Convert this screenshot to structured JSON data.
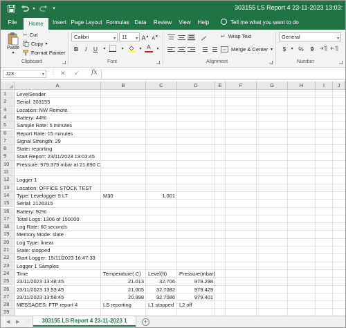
{
  "window": {
    "title": "303155 LS Report 4 23-11-2023 13:03:"
  },
  "quick_access": {
    "save_icon": "save-icon",
    "undo_icon": "undo-icon",
    "redo_icon": "redo-icon",
    "customize_icon": "customize-icon"
  },
  "ribbon_tabs": [
    "File",
    "Home",
    "Insert",
    "Page Layout",
    "Formulas",
    "Data",
    "Review",
    "View",
    "Help"
  ],
  "active_tab": "Home",
  "tell_me": "Tell me what you want to do",
  "ribbon": {
    "clipboard": {
      "paste": "Paste",
      "cut": "Cut",
      "copy": "Copy",
      "format_painter": "Format Painter",
      "label": "Clipboard"
    },
    "font": {
      "name": "Calibri",
      "size": "11",
      "grow": "A",
      "shrink": "A",
      "bold": "B",
      "italic": "I",
      "underline": "U",
      "font_color_letter": "A",
      "label": "Font"
    },
    "alignment": {
      "wrap_text": "Wrap Text",
      "merge_center": "Merge & Center",
      "label": "Alignment"
    },
    "number": {
      "format": "General",
      "currency": "$",
      "percent": "%",
      "comma": "9",
      "label": "Number"
    }
  },
  "formula_bar": {
    "name_box": "J23",
    "cancel": "✕",
    "enter": "✓",
    "fx": "fx",
    "value": ""
  },
  "columns": [
    "A",
    "B",
    "C",
    "D",
    "E",
    "F",
    "G",
    "H",
    "I",
    "J"
  ],
  "rows": [
    "1",
    "2",
    "3",
    "4",
    "5",
    "6",
    "7",
    "8",
    "9",
    "10",
    "11",
    "12",
    "13",
    "14",
    "15",
    "16",
    "17",
    "18",
    "19",
    "20",
    "21",
    "22",
    "23",
    "24",
    "25",
    "26",
    "27",
    "28",
    "29"
  ],
  "cells": {
    "A1": "LevelSender",
    "A2": "Serial: 303155",
    "A3": "Location: NW Remote",
    "A4": "Battery: 44%",
    "A5": "Sample Rate: 5 minutes",
    "A6": "Report Rate: 15 minutes",
    "A7": "Signal Strength: 29",
    "A8": "State: reporting",
    "A9": "Start Report: 23/11/2023 13:03:45",
    "A10": "Pressure: 979.379 mbar at 21.890 C",
    "A12": "Logger 1",
    "A13": "Location: OFFICE STOCK TEST",
    "A14": "Type: Levelogger 5 LT",
    "B14": "M30",
    "C14": "1.001",
    "A15": "Serial: 2126315",
    "A16": "Battery: 92%",
    "A17": "Total Logs: 1306 of 150000",
    "A18": "Log Rate: 60 seconds",
    "A19": "Memory Mode: slate",
    "A20": "Log Type: linear",
    "A21": "State: stopped",
    "A22": "Start Logger: 15/11/2023 16:47:33",
    "A23": "Logger 1 Samples",
    "A24": "Time",
    "B24": "Temperature( C)",
    "C24": "Level(ft)",
    "D24": "Pressure(mbar)",
    "A25": "23/11/2023 13:48:45",
    "B25": "21.013",
    "C25": "32.706",
    "D25": "979.298",
    "A26": "23/11/2023 13:53:45",
    "B26": "21.005",
    "C26": "32.7082",
    "D26": "979.429",
    "A27": "23/11/2023 13:58:45",
    "B27": "20.998",
    "C27": "32.7086",
    "D27": "979.401",
    "A28": "MESSAGES: FTP report 4",
    "B28": "LS reporting",
    "C28": "L1 stopped",
    "D28": "L2 off"
  },
  "sheet_tabs": [
    "303155 LS Report 4 23-11-2023 1"
  ],
  "add_sheet": "+",
  "colors": {
    "accent": "#217346",
    "ribbon_bg": "#f3f3f3",
    "header_bg": "#e8e8e8"
  }
}
